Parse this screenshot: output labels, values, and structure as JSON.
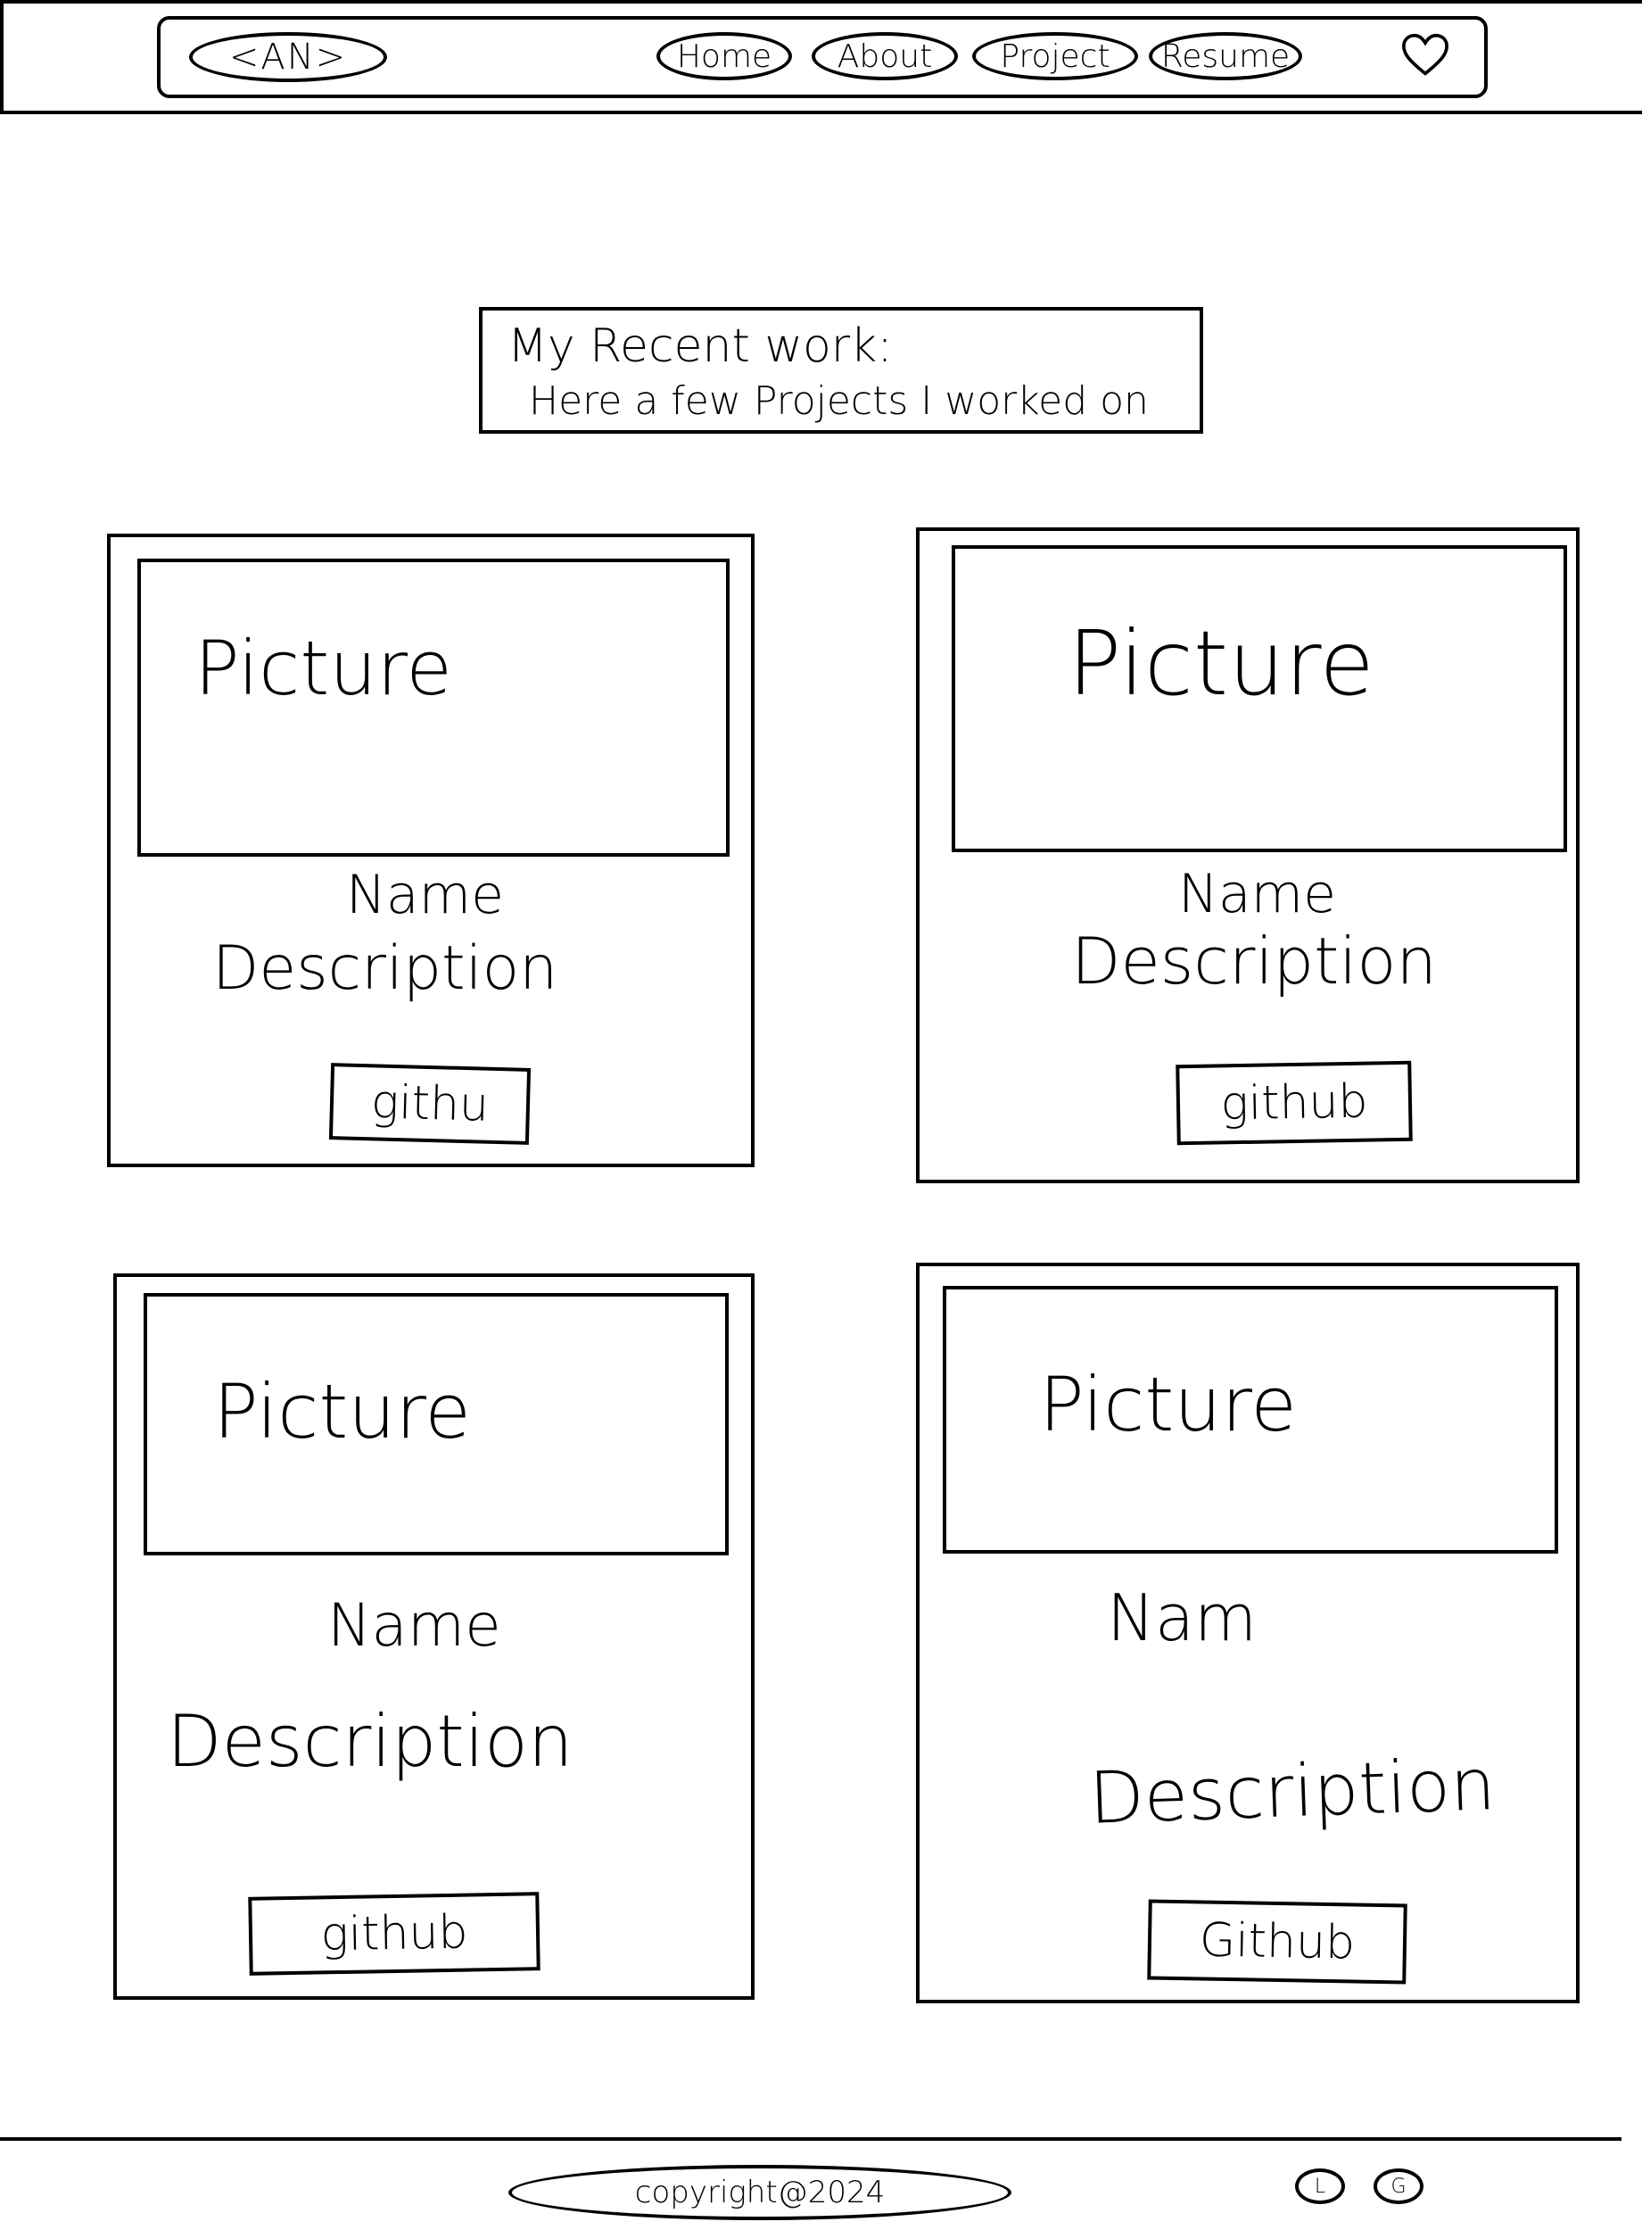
{
  "header": {
    "logo": "<AN>",
    "nav": [
      "Home",
      "About",
      "Project",
      "Resume"
    ],
    "heart_icon": "heart-icon"
  },
  "intro": {
    "heading": "My Recent work:",
    "text": "Here a few Projects I worked on"
  },
  "projects": [
    {
      "picture": "Picture",
      "name": "Name",
      "description": "Description",
      "button": "githu"
    },
    {
      "picture": "Picture",
      "name": "Name",
      "description": "Description",
      "button": "github"
    },
    {
      "picture": "Picture",
      "name": "Name",
      "description": "Description",
      "button": "github"
    },
    {
      "picture": "Picture",
      "name": "Nam",
      "description": "Description",
      "button": "Github"
    }
  ],
  "footer": {
    "copyright": "copyright@2024",
    "icons": [
      "L",
      "G"
    ]
  }
}
